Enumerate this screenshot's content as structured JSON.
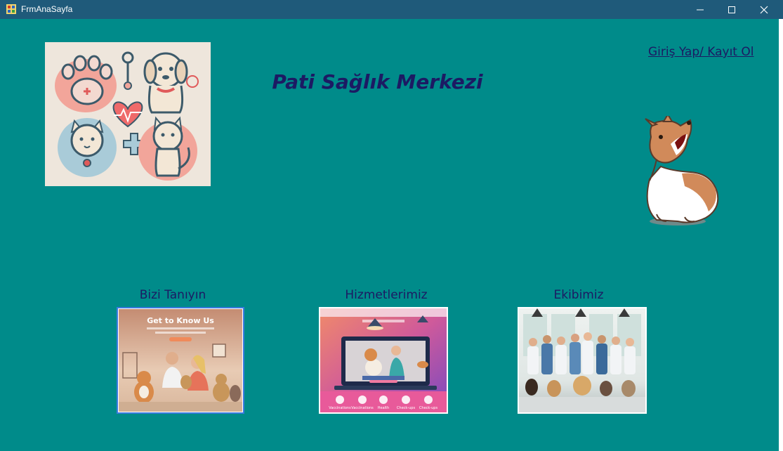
{
  "window": {
    "title": "FrmAnaSayfa",
    "controls": [
      "minimize-icon",
      "maximize-icon",
      "close-icon"
    ]
  },
  "header": {
    "title": "Pati Sağlık Merkezi",
    "login_link": "Giriş Yap/ Kayıt Ol"
  },
  "sections": [
    {
      "label": "Bizi Tanıyın",
      "image_heading": "Get to Know Us"
    },
    {
      "label": "Hizmetlerimiz",
      "image_tabs": [
        "Vaccinations",
        "Vaccinations",
        "Health",
        "Check-ups",
        "Check-ups"
      ]
    },
    {
      "label": "Ekibimiz"
    }
  ],
  "colors": {
    "background": "#008b8a",
    "titlebar": "#1f5a7a",
    "text": "#1c1a63",
    "selected_border": "#3a7be0"
  }
}
